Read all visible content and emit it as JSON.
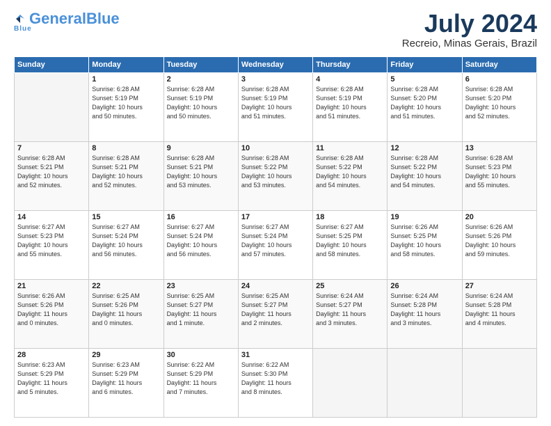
{
  "header": {
    "logo": {
      "part1": "General",
      "part2": "Blue",
      "sub": "Blue"
    },
    "title": "July 2024",
    "location": "Recreio, Minas Gerais, Brazil"
  },
  "columns": [
    "Sunday",
    "Monday",
    "Tuesday",
    "Wednesday",
    "Thursday",
    "Friday",
    "Saturday"
  ],
  "weeks": [
    [
      {
        "day": "",
        "detail": ""
      },
      {
        "day": "1",
        "detail": "Sunrise: 6:28 AM\nSunset: 5:19 PM\nDaylight: 10 hours\nand 50 minutes."
      },
      {
        "day": "2",
        "detail": "Sunrise: 6:28 AM\nSunset: 5:19 PM\nDaylight: 10 hours\nand 50 minutes."
      },
      {
        "day": "3",
        "detail": "Sunrise: 6:28 AM\nSunset: 5:19 PM\nDaylight: 10 hours\nand 51 minutes."
      },
      {
        "day": "4",
        "detail": "Sunrise: 6:28 AM\nSunset: 5:19 PM\nDaylight: 10 hours\nand 51 minutes."
      },
      {
        "day": "5",
        "detail": "Sunrise: 6:28 AM\nSunset: 5:20 PM\nDaylight: 10 hours\nand 51 minutes."
      },
      {
        "day": "6",
        "detail": "Sunrise: 6:28 AM\nSunset: 5:20 PM\nDaylight: 10 hours\nand 52 minutes."
      }
    ],
    [
      {
        "day": "7",
        "detail": "Sunrise: 6:28 AM\nSunset: 5:21 PM\nDaylight: 10 hours\nand 52 minutes."
      },
      {
        "day": "8",
        "detail": "Sunrise: 6:28 AM\nSunset: 5:21 PM\nDaylight: 10 hours\nand 52 minutes."
      },
      {
        "day": "9",
        "detail": "Sunrise: 6:28 AM\nSunset: 5:21 PM\nDaylight: 10 hours\nand 53 minutes."
      },
      {
        "day": "10",
        "detail": "Sunrise: 6:28 AM\nSunset: 5:22 PM\nDaylight: 10 hours\nand 53 minutes."
      },
      {
        "day": "11",
        "detail": "Sunrise: 6:28 AM\nSunset: 5:22 PM\nDaylight: 10 hours\nand 54 minutes."
      },
      {
        "day": "12",
        "detail": "Sunrise: 6:28 AM\nSunset: 5:22 PM\nDaylight: 10 hours\nand 54 minutes."
      },
      {
        "day": "13",
        "detail": "Sunrise: 6:28 AM\nSunset: 5:23 PM\nDaylight: 10 hours\nand 55 minutes."
      }
    ],
    [
      {
        "day": "14",
        "detail": "Sunrise: 6:27 AM\nSunset: 5:23 PM\nDaylight: 10 hours\nand 55 minutes."
      },
      {
        "day": "15",
        "detail": "Sunrise: 6:27 AM\nSunset: 5:24 PM\nDaylight: 10 hours\nand 56 minutes."
      },
      {
        "day": "16",
        "detail": "Sunrise: 6:27 AM\nSunset: 5:24 PM\nDaylight: 10 hours\nand 56 minutes."
      },
      {
        "day": "17",
        "detail": "Sunrise: 6:27 AM\nSunset: 5:24 PM\nDaylight: 10 hours\nand 57 minutes."
      },
      {
        "day": "18",
        "detail": "Sunrise: 6:27 AM\nSunset: 5:25 PM\nDaylight: 10 hours\nand 58 minutes."
      },
      {
        "day": "19",
        "detail": "Sunrise: 6:26 AM\nSunset: 5:25 PM\nDaylight: 10 hours\nand 58 minutes."
      },
      {
        "day": "20",
        "detail": "Sunrise: 6:26 AM\nSunset: 5:26 PM\nDaylight: 10 hours\nand 59 minutes."
      }
    ],
    [
      {
        "day": "21",
        "detail": "Sunrise: 6:26 AM\nSunset: 5:26 PM\nDaylight: 11 hours\nand 0 minutes."
      },
      {
        "day": "22",
        "detail": "Sunrise: 6:25 AM\nSunset: 5:26 PM\nDaylight: 11 hours\nand 0 minutes."
      },
      {
        "day": "23",
        "detail": "Sunrise: 6:25 AM\nSunset: 5:27 PM\nDaylight: 11 hours\nand 1 minute."
      },
      {
        "day": "24",
        "detail": "Sunrise: 6:25 AM\nSunset: 5:27 PM\nDaylight: 11 hours\nand 2 minutes."
      },
      {
        "day": "25",
        "detail": "Sunrise: 6:24 AM\nSunset: 5:27 PM\nDaylight: 11 hours\nand 3 minutes."
      },
      {
        "day": "26",
        "detail": "Sunrise: 6:24 AM\nSunset: 5:28 PM\nDaylight: 11 hours\nand 3 minutes."
      },
      {
        "day": "27",
        "detail": "Sunrise: 6:24 AM\nSunset: 5:28 PM\nDaylight: 11 hours\nand 4 minutes."
      }
    ],
    [
      {
        "day": "28",
        "detail": "Sunrise: 6:23 AM\nSunset: 5:29 PM\nDaylight: 11 hours\nand 5 minutes."
      },
      {
        "day": "29",
        "detail": "Sunrise: 6:23 AM\nSunset: 5:29 PM\nDaylight: 11 hours\nand 6 minutes."
      },
      {
        "day": "30",
        "detail": "Sunrise: 6:22 AM\nSunset: 5:29 PM\nDaylight: 11 hours\nand 7 minutes."
      },
      {
        "day": "31",
        "detail": "Sunrise: 6:22 AM\nSunset: 5:30 PM\nDaylight: 11 hours\nand 8 minutes."
      },
      {
        "day": "",
        "detail": ""
      },
      {
        "day": "",
        "detail": ""
      },
      {
        "day": "",
        "detail": ""
      }
    ]
  ]
}
